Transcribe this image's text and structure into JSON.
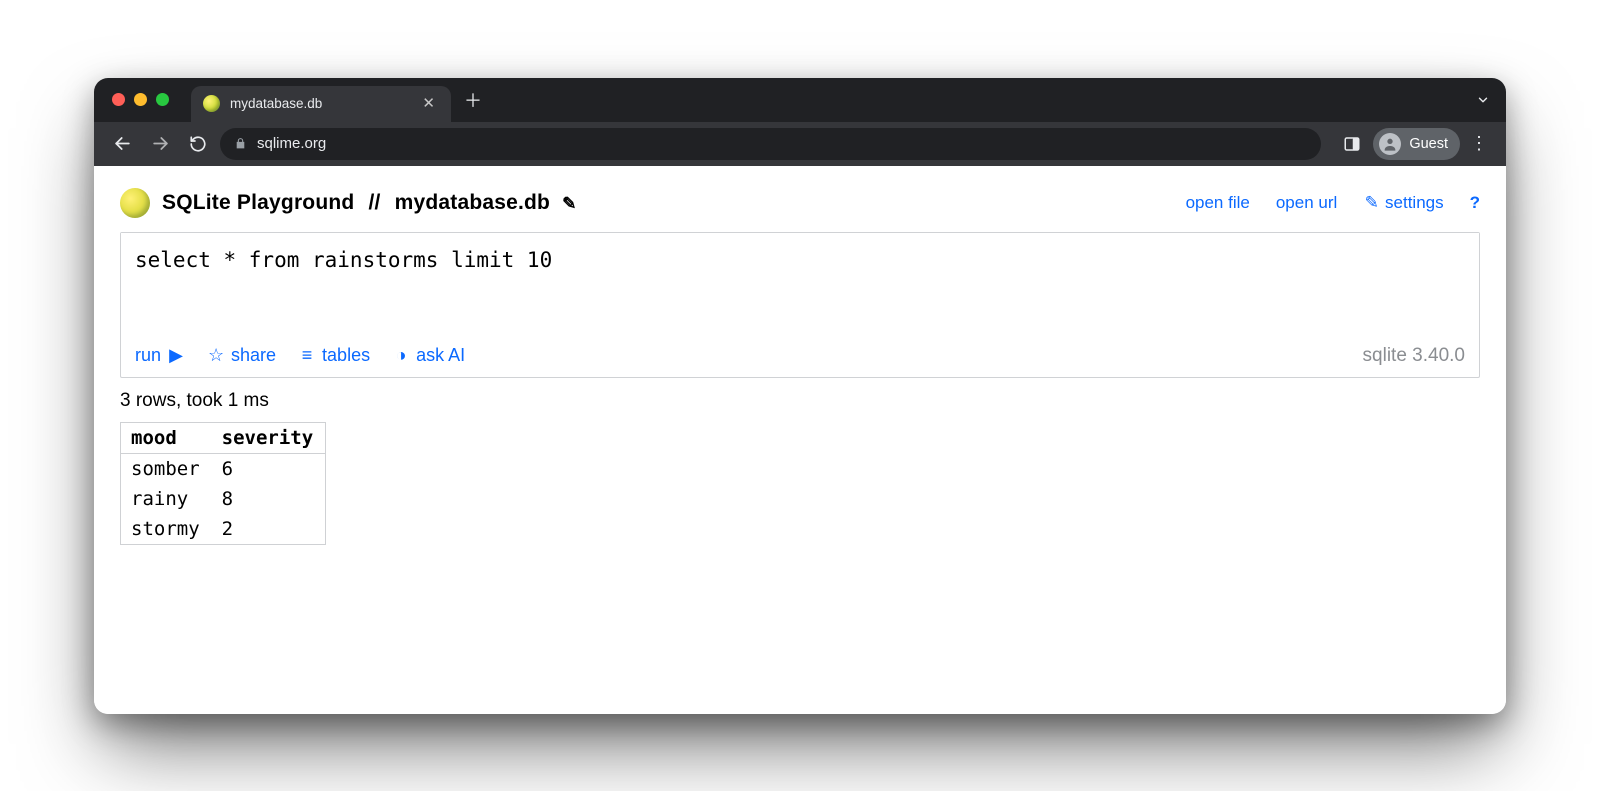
{
  "browser": {
    "tab_title": "mydatabase.db",
    "url_display": "sqlime.org",
    "guest_label": "Guest"
  },
  "header": {
    "app_name": "SQLite Playground",
    "separator": "//",
    "db_name": "mydatabase.db",
    "links": {
      "open_file": "open file",
      "open_url": "open url",
      "settings": "settings",
      "help": "?"
    }
  },
  "editor": {
    "sql": "select * from rainstorms limit 10",
    "actions": {
      "run": "run",
      "share": "share",
      "tables": "tables",
      "ask_ai": "ask AI"
    },
    "version": "sqlite 3.40.0"
  },
  "result": {
    "status": "3 rows, took 1 ms",
    "columns": [
      "mood",
      "severity"
    ],
    "rows": [
      {
        "mood": "somber",
        "severity": "6"
      },
      {
        "mood": "rainy",
        "severity": "8"
      },
      {
        "mood": "stormy",
        "severity": "2"
      }
    ]
  }
}
